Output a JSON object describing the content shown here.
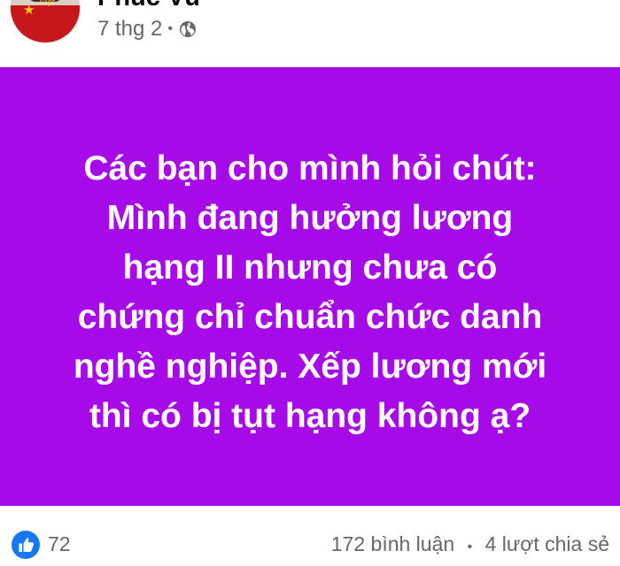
{
  "author": {
    "name": "Phúc Vũ"
  },
  "post_meta": {
    "time": "7 thg 2",
    "separator": "•",
    "audience_icon": "globe-icon"
  },
  "post": {
    "background": "#a70ae8",
    "text": "Các bạn cho mình hỏi chút:\nMình đang hưởng lương\nhạng II nhưng chưa có\nchứng chỉ chuẩn chức danh\nnghề nghiệp. Xếp lương mới\nthì có bị tụt hạng không ạ?"
  },
  "reactions": {
    "icon": "like-icon",
    "count": "72",
    "color": "#1877f2"
  },
  "engagement": {
    "comments": "172 bình luận",
    "separator": "•",
    "shares": "4 lượt chia sẻ"
  }
}
